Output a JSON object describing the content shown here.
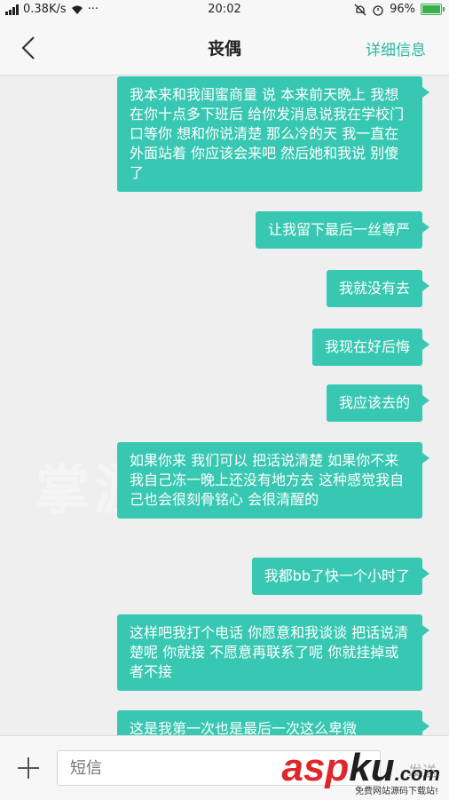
{
  "status_bar": {
    "network": "0.38K/s",
    "dots": "···",
    "time": "20:02",
    "battery": "96%"
  },
  "header": {
    "title": "丧偶",
    "details_label": "详细信息"
  },
  "messages": [
    {
      "text": "我本来和我闺蜜商量 说 本来前天晚上 我想在你十点多下班后 给你发消息说我在学校门口等你 想和你说清楚 那么冷的天 我一直在外面站着 你应该会来吧 然后她和我说 别傻了"
    },
    {
      "text": "让我留下最后一丝尊严"
    },
    {
      "text": "我就没有去"
    },
    {
      "text": "我现在好后悔"
    },
    {
      "text": "我应该去的"
    },
    {
      "text": "如果你来 我们可以 把话说清楚 如果你不来 我自己冻一晚上还没有地方去 这种感觉我自己也会很刻骨铭心 会很清醒的"
    },
    {
      "text": "我都bb了快一个小时了"
    },
    {
      "text": "这样吧我打个电话 你愿意和我谈谈 把话说清楚呢 你就接 不愿意再联系了呢 你就挂掉或者不接"
    },
    {
      "text": "这是我第一次也是最后一次这么卑微"
    }
  ],
  "watermark": "掌游宝",
  "input": {
    "placeholder": "短信",
    "send_label": "发送"
  },
  "logo": {
    "main_a": "asp",
    "main_b": "ku",
    "suffix": ".com",
    "tagline": "免费网站源码下载站!"
  },
  "colors": {
    "bubble": "#38c7b2",
    "accent": "#2ab8a3"
  }
}
